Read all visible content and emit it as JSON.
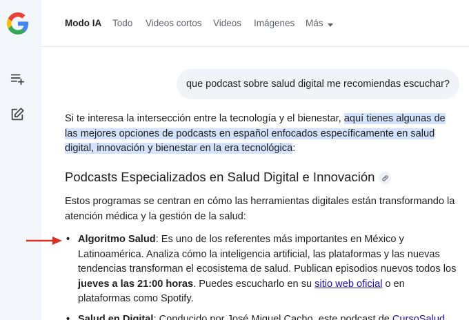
{
  "tabs": [
    "Modo IA",
    "Todo",
    "Videos cortos",
    "Videos",
    "Imágenes",
    "Más"
  ],
  "query": "que podcast sobre salud digital me recomiendas escuchar?",
  "intro": {
    "plain": "Si te interesa la intersección entre la tecnología y el bienestar, ",
    "highlight": "aquí tienes algunas de las mejores opciones de podcasts en español enfocados específicamente en salud digital, innovación y bienestar en la era tecnológica",
    "end": ":"
  },
  "heading": "Podcasts Especializados en Salud Digital e Innovación",
  "subtext": "Estos programas se centran en cómo las herramientas digitales están transformando la atención médica y la gestión de la salud:",
  "items": [
    {
      "title": "Algoritmo Salud",
      "text1": ": Es uno de los referentes más importantes en México y Latinoamérica. Analiza cómo la inteligencia artificial, las plataformas y las nuevas tendencias transforman el ecosistema de salud. Publican episodios nuevos todos los ",
      "bold2": "jueves a las 21:00 horas",
      "text2": ". Puedes escucharlo en su ",
      "link": "sitio web oficial",
      "text3": " o en plataformas como Spotify."
    },
    {
      "title": "Salud en Digital",
      "text1": ": Conducido por José Miguel Cacho, este podcast de ",
      "link": "CursoSalud"
    }
  ],
  "colors": {
    "accent": "#d3e3fd",
    "link": "#1a0dab",
    "arrow": "#d93025",
    "rail": "#f3f6fb"
  }
}
